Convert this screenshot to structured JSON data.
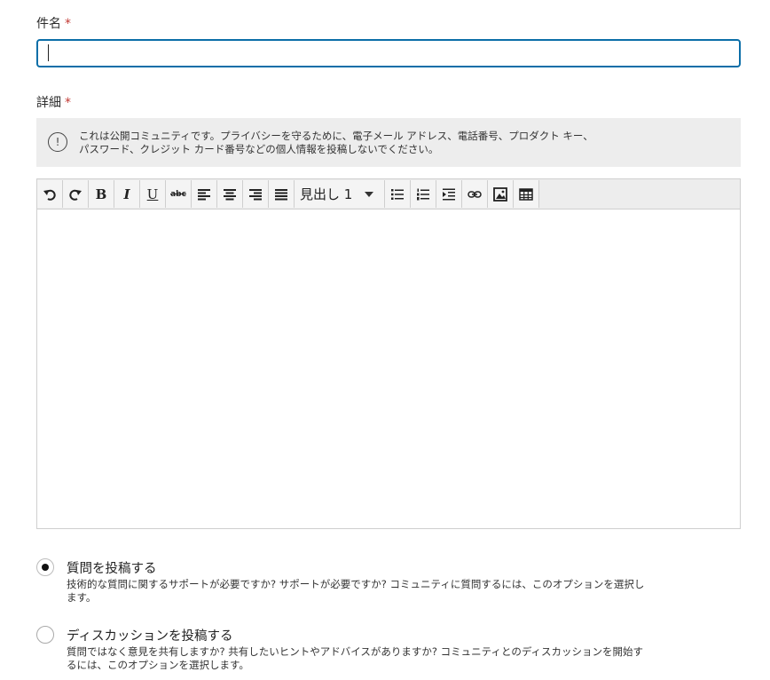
{
  "form": {
    "subject_label": "件名",
    "required_mark": "*",
    "subject_value": "",
    "details_label": "詳細",
    "notice_text": "これは公開コミュニティです。プライバシーを守るために、電子メール アドレス、電話番号、プロダクト キー、パスワード、クレジット カード番号などの個人情報を投稿しないでください。",
    "notice_icon_glyph": "!"
  },
  "toolbar": {
    "undo_icon": "undo-icon",
    "redo_icon": "redo-icon",
    "bold": "B",
    "italic": "I",
    "underline": "U",
    "strike": "abc",
    "heading_value": "見出し 1"
  },
  "options": {
    "question_title": "質問を投稿する",
    "question_desc": "技術的な質問に関するサポートが必要ですか? サポートが必要ですか? コミュニティに質問するには、このオプションを選択します。",
    "question_checked": true,
    "discussion_title": "ディスカッションを投稿する",
    "discussion_desc": "質問ではなく意見を共有しますか? 共有したいヒントやアドバイスがありますか? コミュニティとのディスカッションを開始するには、このオプションを選択します。",
    "discussion_checked": false
  },
  "colors": {
    "focus_border": "#0b6ea8",
    "required": "#c23934",
    "notice_bg": "#ededed"
  }
}
